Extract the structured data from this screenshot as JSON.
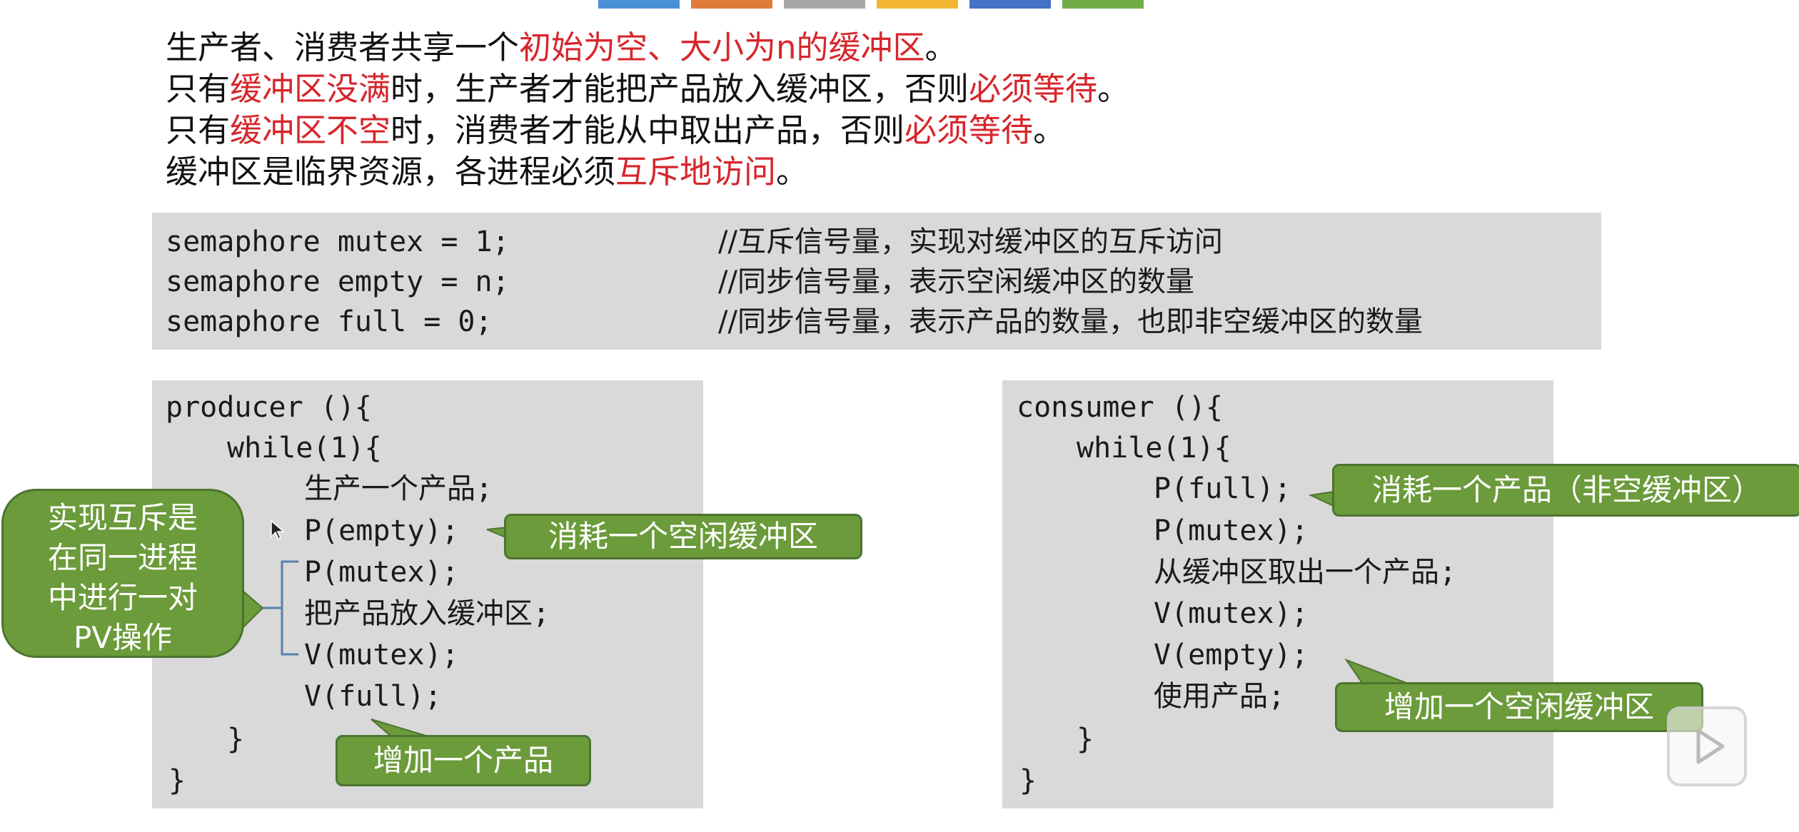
{
  "slide": {
    "top_strip_colors": [
      "#4a90d9",
      "#e07b39",
      "#a6a6a6",
      "#f2b632",
      "#4472c4",
      "#70ad47"
    ],
    "intro": {
      "line1": {
        "a": "生产者、消费者共享一个",
        "b": "初始为空、大小为n的缓冲区",
        "c": "。"
      },
      "line2": {
        "a": "只有",
        "b": "缓冲区没满",
        "c": "时，生产者才能把产品放入缓冲区，否则",
        "d": "必须等待",
        "e": "。"
      },
      "line3": {
        "a": "只有",
        "b": "缓冲区不空",
        "c": "时，消费者才能从中取出产品，否则",
        "d": "必须等待",
        "e": "。"
      },
      "line4": {
        "a": "缓冲区是临界资源，各进程必须",
        "b": "互斥地访问",
        "c": "。"
      }
    },
    "semaphores": [
      {
        "code": "semaphore mutex = 1;",
        "comment": "//互斥信号量，实现对缓冲区的互斥访问"
      },
      {
        "code": "semaphore empty = n;",
        "comment": "//同步信号量，表示空闲缓冲区的数量"
      },
      {
        "code": "semaphore full = 0;",
        "comment": "//同步信号量，表示产品的数量，也即非空缓冲区的数量"
      }
    ],
    "producer": {
      "lines": [
        "producer (){",
        "while(1){",
        "生产一个产品;",
        "P(empty);",
        "P(mutex);",
        "把产品放入缓冲区;",
        "V(mutex);",
        "V(full);",
        "}",
        "}"
      ]
    },
    "consumer": {
      "lines": [
        "consumer (){",
        "while(1){",
        "P(full);",
        "P(mutex);",
        "从缓冲区取出一个产品;",
        "V(mutex);",
        "V(empty);",
        "使用产品;",
        "}",
        "}"
      ]
    },
    "callouts": {
      "mutex_note": [
        "实现互斥是",
        "在同一进程",
        "中进行一对",
        "PV操作"
      ],
      "consume_empty": "消耗一个空闲缓冲区",
      "add_product": "增加一个产品",
      "consume_product": "消耗一个产品（非空缓冲区）",
      "add_empty": "增加一个空闲缓冲区"
    },
    "colors": {
      "accent_red": "#d6262c",
      "callout_green": "#6b9b3a",
      "code_bg": "#d9d9d9"
    },
    "watermark_icon": "play-icon"
  }
}
